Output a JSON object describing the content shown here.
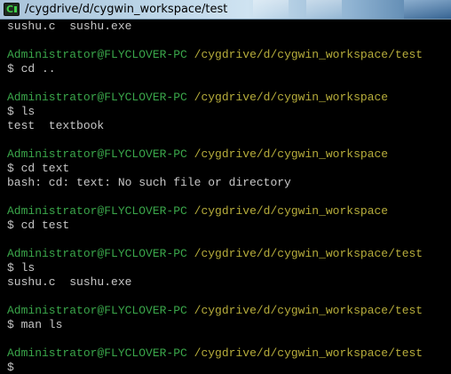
{
  "window": {
    "title": "/cygdrive/d/cygwin_workspace/test",
    "icon": "cygwin-terminal-icon"
  },
  "colors": {
    "background": "#000000",
    "text": "#c7c7c7",
    "prompt_user": "#3aa64a",
    "prompt_path": "#b7ad3b"
  },
  "terminal": {
    "lines": [
      {
        "type": "output",
        "text": "sushu.c  sushu.exe"
      },
      {
        "type": "blank",
        "text": ""
      },
      {
        "type": "prompt",
        "user": "Administrator@FLYCLOVER-PC",
        "path": "/cygdrive/d/cygwin_workspace/test"
      },
      {
        "type": "command",
        "text": "$ cd .."
      },
      {
        "type": "blank",
        "text": ""
      },
      {
        "type": "prompt",
        "user": "Administrator@FLYCLOVER-PC",
        "path": "/cygdrive/d/cygwin_workspace"
      },
      {
        "type": "command",
        "text": "$ ls"
      },
      {
        "type": "output",
        "text": "test  textbook"
      },
      {
        "type": "blank",
        "text": ""
      },
      {
        "type": "prompt",
        "user": "Administrator@FLYCLOVER-PC",
        "path": "/cygdrive/d/cygwin_workspace"
      },
      {
        "type": "command",
        "text": "$ cd text"
      },
      {
        "type": "output",
        "text": "bash: cd: text: No such file or directory"
      },
      {
        "type": "blank",
        "text": ""
      },
      {
        "type": "prompt",
        "user": "Administrator@FLYCLOVER-PC",
        "path": "/cygdrive/d/cygwin_workspace"
      },
      {
        "type": "command",
        "text": "$ cd test"
      },
      {
        "type": "blank",
        "text": ""
      },
      {
        "type": "prompt",
        "user": "Administrator@FLYCLOVER-PC",
        "path": "/cygdrive/d/cygwin_workspace/test"
      },
      {
        "type": "command",
        "text": "$ ls"
      },
      {
        "type": "output",
        "text": "sushu.c  sushu.exe"
      },
      {
        "type": "blank",
        "text": ""
      },
      {
        "type": "prompt",
        "user": "Administrator@FLYCLOVER-PC",
        "path": "/cygdrive/d/cygwin_workspace/test"
      },
      {
        "type": "command",
        "text": "$ man ls"
      },
      {
        "type": "blank",
        "text": ""
      },
      {
        "type": "prompt",
        "user": "Administrator@FLYCLOVER-PC",
        "path": "/cygdrive/d/cygwin_workspace/test"
      },
      {
        "type": "command",
        "text": "$"
      }
    ]
  }
}
